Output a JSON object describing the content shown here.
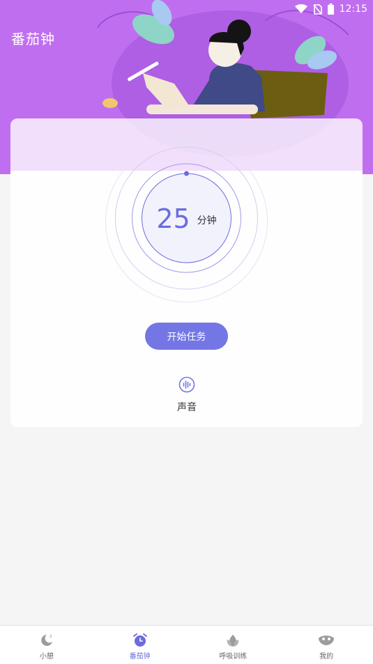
{
  "status_bar": {
    "time": "12:15",
    "icons": [
      "wifi-icon",
      "no-sim-icon",
      "battery-icon"
    ]
  },
  "header": {
    "title": "番茄钟"
  },
  "timer": {
    "minutes": "25",
    "unit": "分钟"
  },
  "actions": {
    "start_label": "开始任务"
  },
  "sound": {
    "label": "声音",
    "icon": "sound-wave-icon"
  },
  "bottom_nav": {
    "items": [
      {
        "label": "小憩",
        "icon": "moon-sleep-icon",
        "active": false
      },
      {
        "label": "番茄钟",
        "icon": "alarm-clock-icon",
        "active": true
      },
      {
        "label": "呼吸训练",
        "icon": "plant-icon",
        "active": false
      },
      {
        "label": "我的",
        "icon": "profile-mask-icon",
        "active": false
      }
    ]
  },
  "colors": {
    "accent": "#7476e6",
    "hero": "#c06ef0",
    "inactive": "#999999"
  }
}
